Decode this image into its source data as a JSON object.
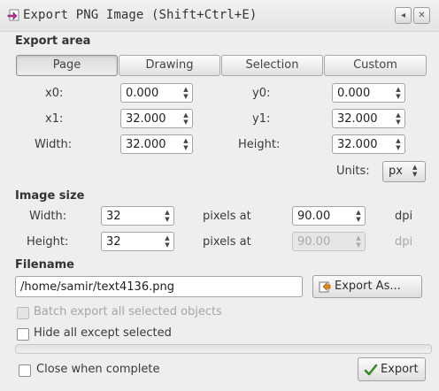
{
  "window": {
    "title": "Export PNG Image (Shift+Ctrl+E)",
    "btn_iconify": "◂",
    "btn_close": "✕"
  },
  "export_area": {
    "heading": "Export area",
    "tabs": [
      "Page",
      "Drawing",
      "Selection",
      "Custom"
    ],
    "active_tab": "Page",
    "x0": {
      "label": "x0:",
      "value": "0.000"
    },
    "y0": {
      "label": "y0:",
      "value": "0.000"
    },
    "x1": {
      "label": "x1:",
      "value": "32.000"
    },
    "y1": {
      "label": "y1:",
      "value": "32.000"
    },
    "width": {
      "label": "Width:",
      "value": "32.000"
    },
    "height": {
      "label": "Height:",
      "value": "32.000"
    },
    "units": {
      "label": "Units:",
      "value": "px"
    }
  },
  "image_size": {
    "heading": "Image size",
    "width": {
      "label": "Width:",
      "value": "32",
      "pixels_at": "pixels at",
      "dpi_value": "90.00",
      "dpi_unit": "dpi"
    },
    "height": {
      "label": "Height:",
      "value": "32",
      "pixels_at": "pixels at",
      "dpi_value": "90.00",
      "dpi_unit": "dpi"
    }
  },
  "filename": {
    "heading": "Filename",
    "value": "/home/samir/text4136.png",
    "export_as_label": "Export As..."
  },
  "options": {
    "batch_label": "Batch export all selected objects",
    "hide_label": "Hide all except selected",
    "close_label": "Close when complete"
  },
  "footer": {
    "export_label": "Export"
  },
  "colors": {
    "check_green": "#3a8a2a",
    "icon_magenta": "#c0309a"
  }
}
